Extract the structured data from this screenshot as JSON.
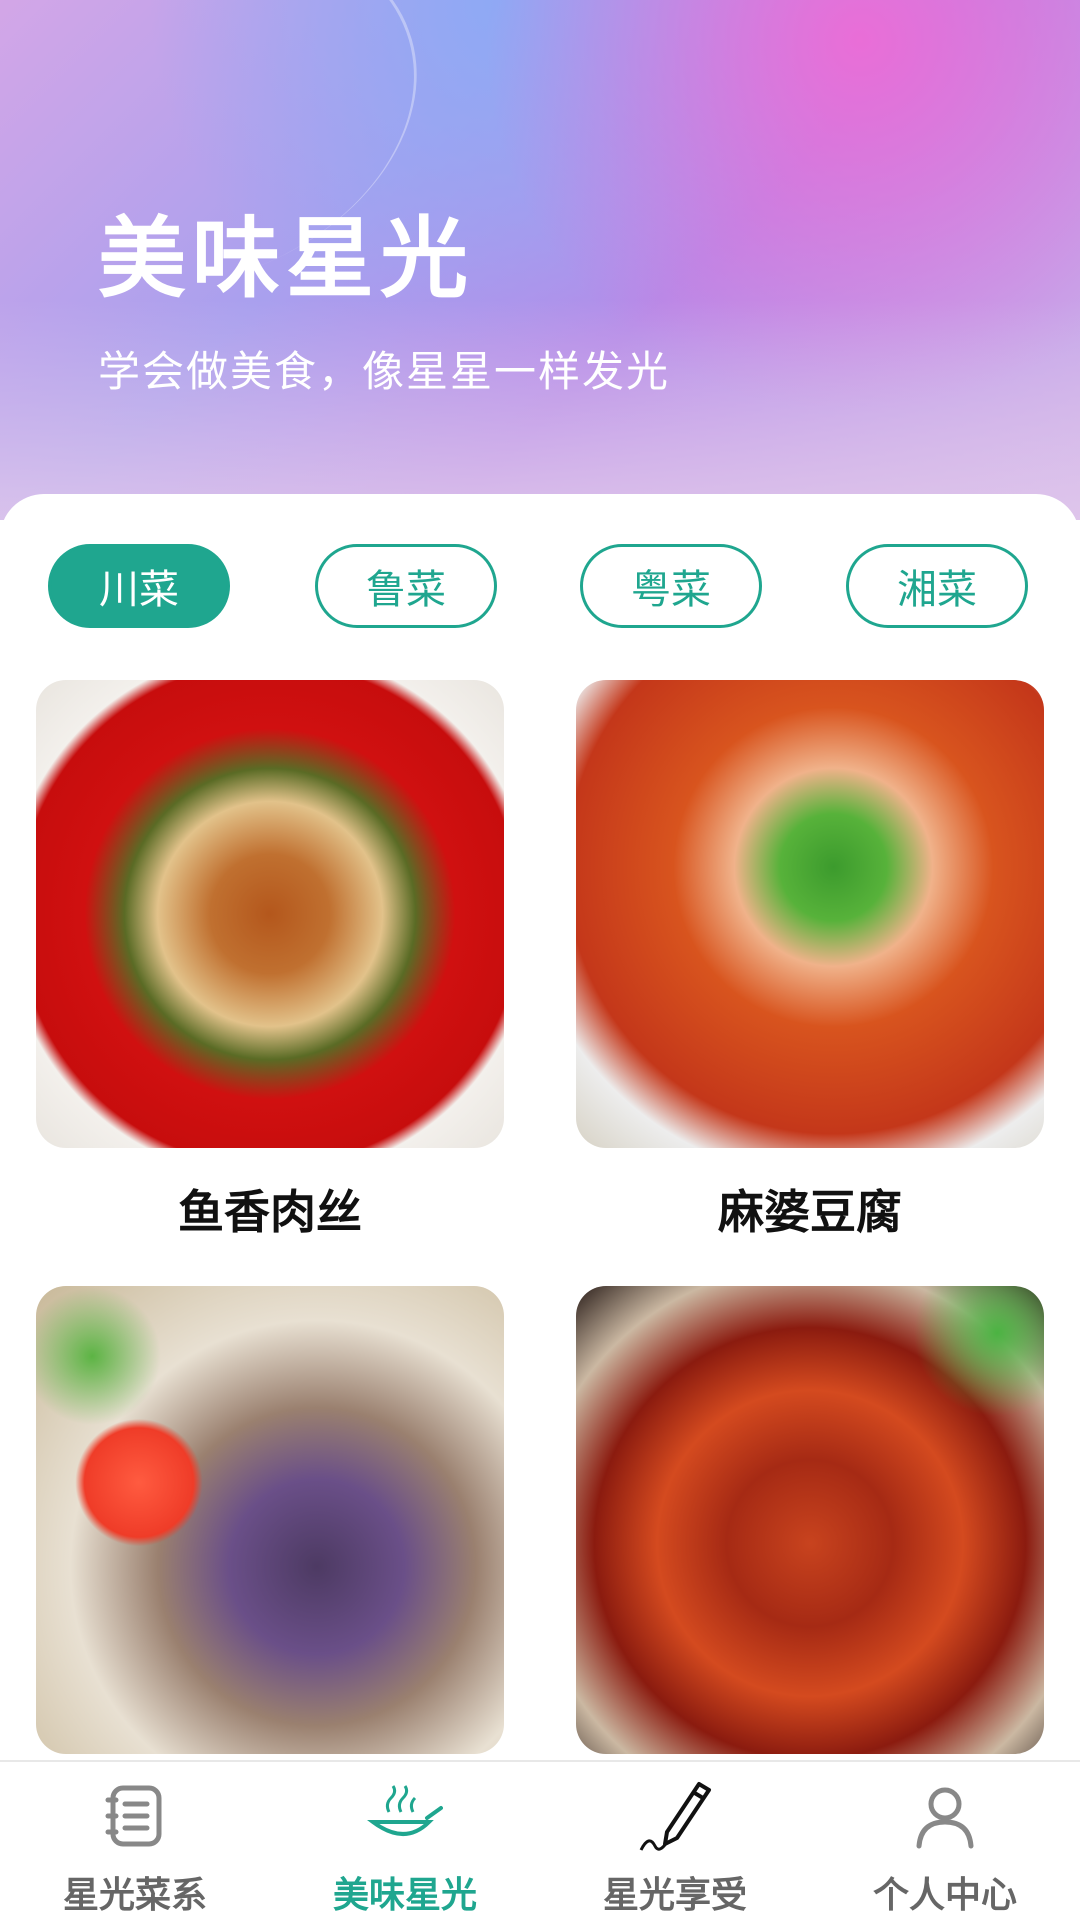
{
  "hero": {
    "title": "美味星光",
    "subtitle": "学会做美食，像星星一样发光"
  },
  "tabs": [
    {
      "label": "川菜",
      "active": true
    },
    {
      "label": "鲁菜",
      "active": false
    },
    {
      "label": "粤菜",
      "active": false
    },
    {
      "label": "湘菜",
      "active": false
    }
  ],
  "dishes": [
    {
      "name": "鱼香肉丝"
    },
    {
      "name": "麻婆豆腐"
    },
    {
      "name": ""
    },
    {
      "name": ""
    }
  ],
  "bottom_nav": [
    {
      "label": "星光菜系",
      "icon": "menu-book-icon",
      "active": false
    },
    {
      "label": "美味星光",
      "icon": "cooking-pan-icon",
      "active": true
    },
    {
      "label": "星光享受",
      "icon": "pencil-icon",
      "active": false
    },
    {
      "label": "个人中心",
      "icon": "user-icon",
      "active": false
    }
  ],
  "colors": {
    "accent": "#1fa68f",
    "text_inactive": "#666666"
  }
}
